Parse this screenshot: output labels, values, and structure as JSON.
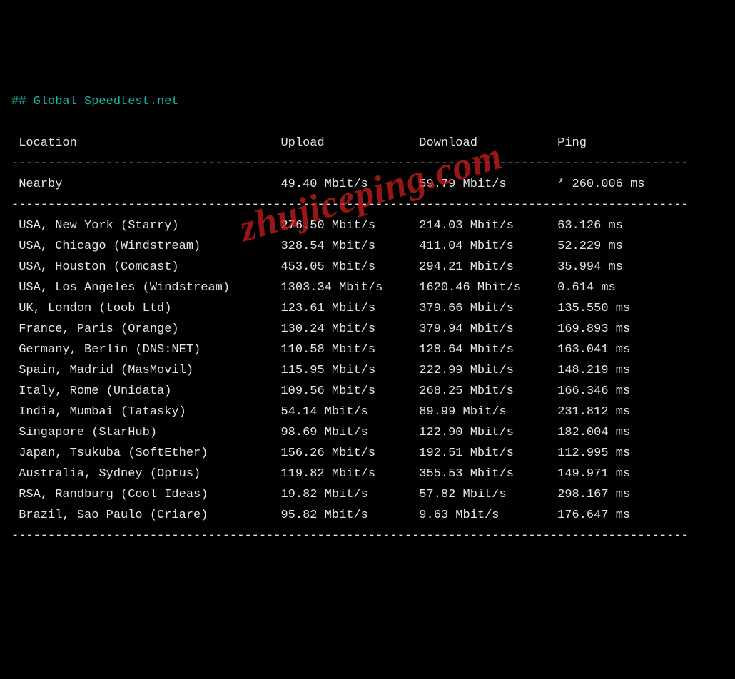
{
  "heading": "## Global Speedtest.net",
  "columns": {
    "c0": "Location",
    "c1": "Upload",
    "c2": "Download",
    "c3": "Ping"
  },
  "sep": "---------------------------------------------------------------------------------------------",
  "nearby": {
    "loc": "Nearby",
    "up": "49.40 Mbit/s",
    "down": "59.79 Mbit/s",
    "ping": "* 260.006 ms"
  },
  "rows": [
    {
      "loc": "USA, New York (Starry)",
      "up": "276.50 Mbit/s",
      "down": "214.03 Mbit/s",
      "ping": "63.126 ms"
    },
    {
      "loc": "USA, Chicago (Windstream)",
      "up": "328.54 Mbit/s",
      "down": "411.04 Mbit/s",
      "ping": "52.229 ms"
    },
    {
      "loc": "USA, Houston (Comcast)",
      "up": "453.05 Mbit/s",
      "down": "294.21 Mbit/s",
      "ping": "35.994 ms"
    },
    {
      "loc": "USA, Los Angeles (Windstream)",
      "up": "1303.34 Mbit/s",
      "down": "1620.46 Mbit/s",
      "ping": "0.614 ms"
    },
    {
      "loc": "UK, London (toob Ltd)",
      "up": "123.61 Mbit/s",
      "down": "379.66 Mbit/s",
      "ping": "135.550 ms"
    },
    {
      "loc": "France, Paris (Orange)",
      "up": "130.24 Mbit/s",
      "down": "379.94 Mbit/s",
      "ping": "169.893 ms"
    },
    {
      "loc": "Germany, Berlin (DNS:NET)",
      "up": "110.58 Mbit/s",
      "down": "128.64 Mbit/s",
      "ping": "163.041 ms"
    },
    {
      "loc": "Spain, Madrid (MasMovil)",
      "up": "115.95 Mbit/s",
      "down": "222.99 Mbit/s",
      "ping": "148.219 ms"
    },
    {
      "loc": "Italy, Rome (Unidata)",
      "up": "109.56 Mbit/s",
      "down": "268.25 Mbit/s",
      "ping": "166.346 ms"
    },
    {
      "loc": "India, Mumbai (Tatasky)",
      "up": "54.14 Mbit/s",
      "down": "89.99 Mbit/s",
      "ping": "231.812 ms"
    },
    {
      "loc": "Singapore (StarHub)",
      "up": "98.69 Mbit/s",
      "down": "122.90 Mbit/s",
      "ping": "182.004 ms"
    },
    {
      "loc": "Japan, Tsukuba (SoftEther)",
      "up": "156.26 Mbit/s",
      "down": "192.51 Mbit/s",
      "ping": "112.995 ms"
    },
    {
      "loc": "Australia, Sydney (Optus)",
      "up": "119.82 Mbit/s",
      "down": "355.53 Mbit/s",
      "ping": "149.971 ms"
    },
    {
      "loc": "RSA, Randburg (Cool Ideas)",
      "up": "19.82 Mbit/s",
      "down": "57.82 Mbit/s",
      "ping": "298.167 ms"
    },
    {
      "loc": "Brazil, Sao Paulo (Criare)",
      "up": "95.82 Mbit/s",
      "down": "9.63 Mbit/s",
      "ping": "176.647 ms"
    }
  ],
  "watermark": "zhujiceping.com",
  "chart_data": {
    "type": "table",
    "title": "Global Speedtest.net",
    "columns": [
      "Location",
      "Upload (Mbit/s)",
      "Download (Mbit/s)",
      "Ping (ms)"
    ],
    "rows": [
      [
        "Nearby",
        49.4,
        59.79,
        260.006
      ],
      [
        "USA, New York (Starry)",
        276.5,
        214.03,
        63.126
      ],
      [
        "USA, Chicago (Windstream)",
        328.54,
        411.04,
        52.229
      ],
      [
        "USA, Houston (Comcast)",
        453.05,
        294.21,
        35.994
      ],
      [
        "USA, Los Angeles (Windstream)",
        1303.34,
        1620.46,
        0.614
      ],
      [
        "UK, London (toob Ltd)",
        123.61,
        379.66,
        135.55
      ],
      [
        "France, Paris (Orange)",
        130.24,
        379.94,
        169.893
      ],
      [
        "Germany, Berlin (DNS:NET)",
        110.58,
        128.64,
        163.041
      ],
      [
        "Spain, Madrid (MasMovil)",
        115.95,
        222.99,
        148.219
      ],
      [
        "Italy, Rome (Unidata)",
        109.56,
        268.25,
        166.346
      ],
      [
        "India, Mumbai (Tatasky)",
        54.14,
        89.99,
        231.812
      ],
      [
        "Singapore (StarHub)",
        98.69,
        122.9,
        182.004
      ],
      [
        "Japan, Tsukuba (SoftEther)",
        156.26,
        192.51,
        112.995
      ],
      [
        "Australia, Sydney (Optus)",
        119.82,
        355.53,
        149.971
      ],
      [
        "RSA, Randburg (Cool Ideas)",
        19.82,
        57.82,
        298.167
      ],
      [
        "Brazil, Sao Paulo (Criare)",
        95.82,
        9.63,
        176.647
      ]
    ]
  }
}
